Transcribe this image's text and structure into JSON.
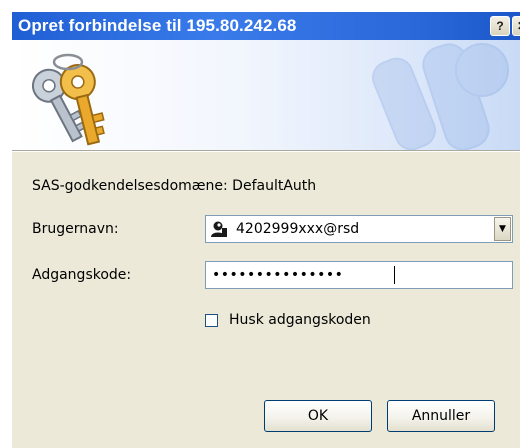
{
  "window": {
    "title": "Opret forbindelse til 195.80.242.68",
    "help_button": "?",
    "close_button": "✕"
  },
  "banner": {
    "icon": "keys-icon",
    "background_icon": "keys-watermark-icon"
  },
  "form": {
    "domain_text": "SAS-godkendelsesdomæne: DefaultAuth",
    "username_label": "Brugernavn:",
    "username_value": "4202999xxx@rsd",
    "username_icon": "user-icon",
    "password_label": "Adgangskode:",
    "password_value": "•••••••••••••••",
    "remember_label": "Husk adgangskoden",
    "remember_checked": false
  },
  "buttons": {
    "ok": "OK",
    "cancel": "Annuller"
  },
  "colors": {
    "titlebar": "#2a67d8",
    "dialog_bg": "#ece9d8",
    "field_border": "#7f9db9",
    "button_border": "#003c74"
  }
}
